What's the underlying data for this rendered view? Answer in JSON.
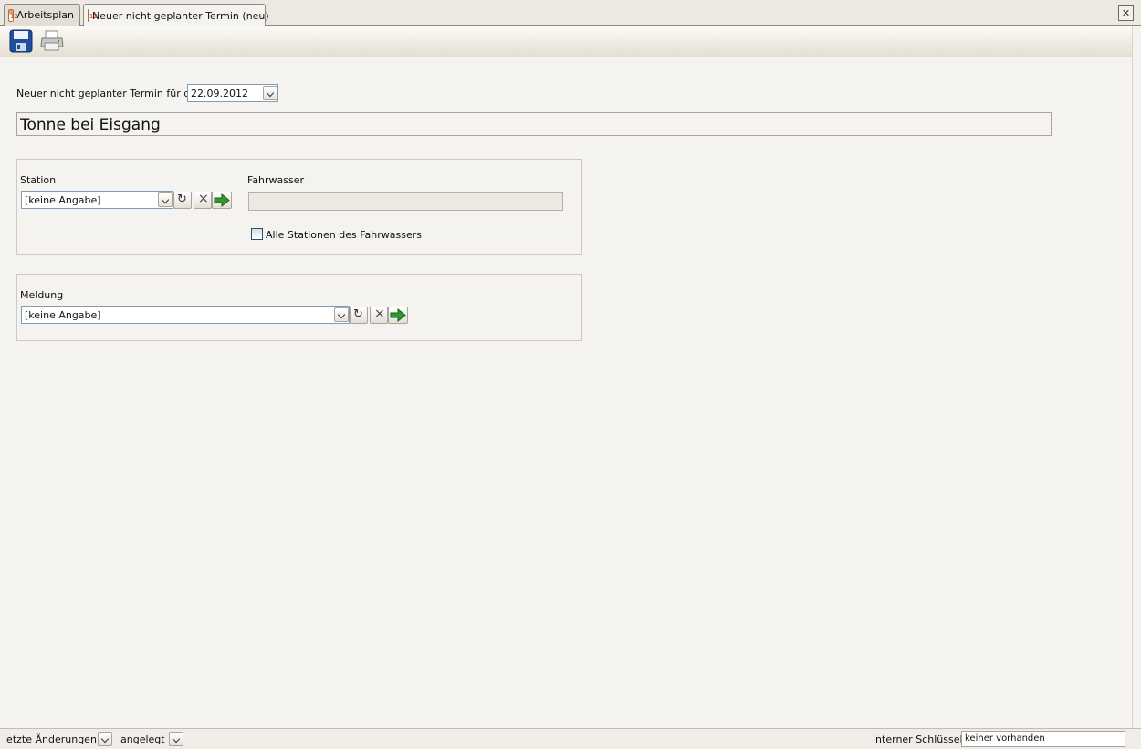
{
  "tabs": [
    {
      "label": "Arbeitsplan",
      "active": false
    },
    {
      "label": "Neuer nicht geplanter Termin (neu)",
      "active": true
    }
  ],
  "toolbar": {
    "save_icon": "save-icon",
    "print_icon": "print-icon"
  },
  "header": {
    "date_label": "Neuer nicht geplanter Termin für den",
    "date_value": "22.09.2012",
    "title_value": "Tonne bei Eisgang"
  },
  "station_group": {
    "station_label": "Station",
    "station_value": "[keine Angabe]",
    "fahrwasser_label": "Fahrwasser",
    "fahrwasser_value": "",
    "checkbox_label": "Alle Stationen des Fahrwassers",
    "checkbox_checked": false
  },
  "meldung_group": {
    "meldung_label": "Meldung",
    "meldung_value": "[keine Angabe]"
  },
  "statusbar": {
    "last_changes_label": "letzte Änderungen",
    "created_label": "angelegt",
    "key_label": "interner Schlüssel",
    "key_value": "keiner vorhanden"
  },
  "colors": {
    "background": "#f5f3ef",
    "accent_go": "#2e9a2e",
    "save_blue": "#1e4f9c"
  }
}
